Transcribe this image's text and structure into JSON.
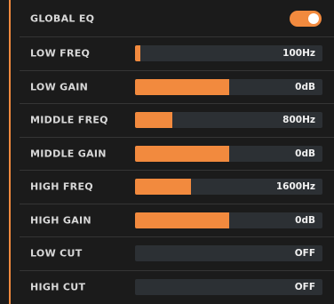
{
  "colors": {
    "accent": "#f28a3e",
    "track": "#2c3034",
    "background": "#1b1b1b",
    "text": "#d8d8d8"
  },
  "global_eq": {
    "label": "GLOBAL EQ",
    "enabled": true
  },
  "params": [
    {
      "id": "low-freq",
      "label": "LOW FREQ",
      "value": "100Hz",
      "level": 0.03
    },
    {
      "id": "low-gain",
      "label": "LOW GAIN",
      "value": "0dB",
      "level": 0.5
    },
    {
      "id": "middle-freq",
      "label": "MIDDLE FREQ",
      "value": "800Hz",
      "level": 0.2
    },
    {
      "id": "middle-gain",
      "label": "MIDDLE GAIN",
      "value": "0dB",
      "level": 0.5
    },
    {
      "id": "high-freq",
      "label": "HIGH FREQ",
      "value": "1600Hz",
      "level": 0.3
    },
    {
      "id": "high-gain",
      "label": "HIGH GAIN",
      "value": "0dB",
      "level": 0.5
    },
    {
      "id": "low-cut",
      "label": "LOW CUT",
      "value": "OFF",
      "level": 0
    },
    {
      "id": "high-cut",
      "label": "HIGH CUT",
      "value": "OFF",
      "level": 0
    }
  ]
}
